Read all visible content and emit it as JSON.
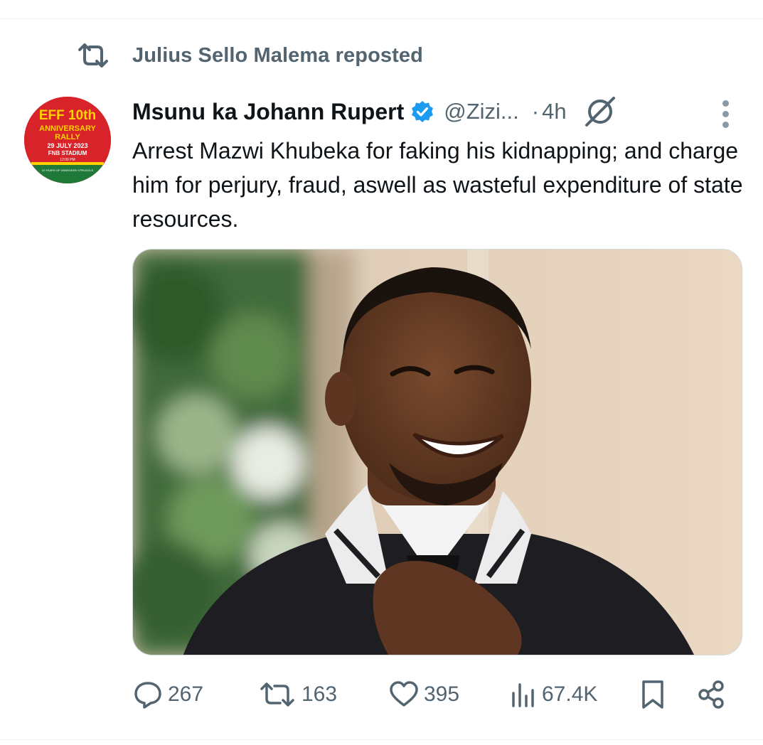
{
  "repost_banner": {
    "text": "Julius Sello Malema reposted",
    "icon": "repost-icon"
  },
  "tweet": {
    "avatar": {
      "lines": [
        "EFF 10th",
        "ANNIVERSARY",
        "RALLY",
        "29 JULY 2023",
        "FNB STADIUM",
        "12:00 PM",
        "10 YEARS OF UNBROKEN STRUGGLE"
      ]
    },
    "author_name": "Msunu ka Johann Rupert",
    "verified_icon": "verified-badge-icon",
    "handle": "@Zizi...",
    "separator": "·",
    "time": "4h",
    "text": "Arrest Mazwi Khubeka for faking his kidnapping; and charge him for perjury, fraud, aswell as wasteful expenditure of state resources.",
    "media_icon": "photo-of-smiling-man",
    "actions": {
      "replies": "267",
      "reposts": "163",
      "likes": "395",
      "views": "67.4K"
    }
  },
  "colors": {
    "text_primary": "#0f1419",
    "text_secondary": "#536471",
    "verified_blue": "#1d9bf0",
    "avatar_red": "#d8232a"
  }
}
